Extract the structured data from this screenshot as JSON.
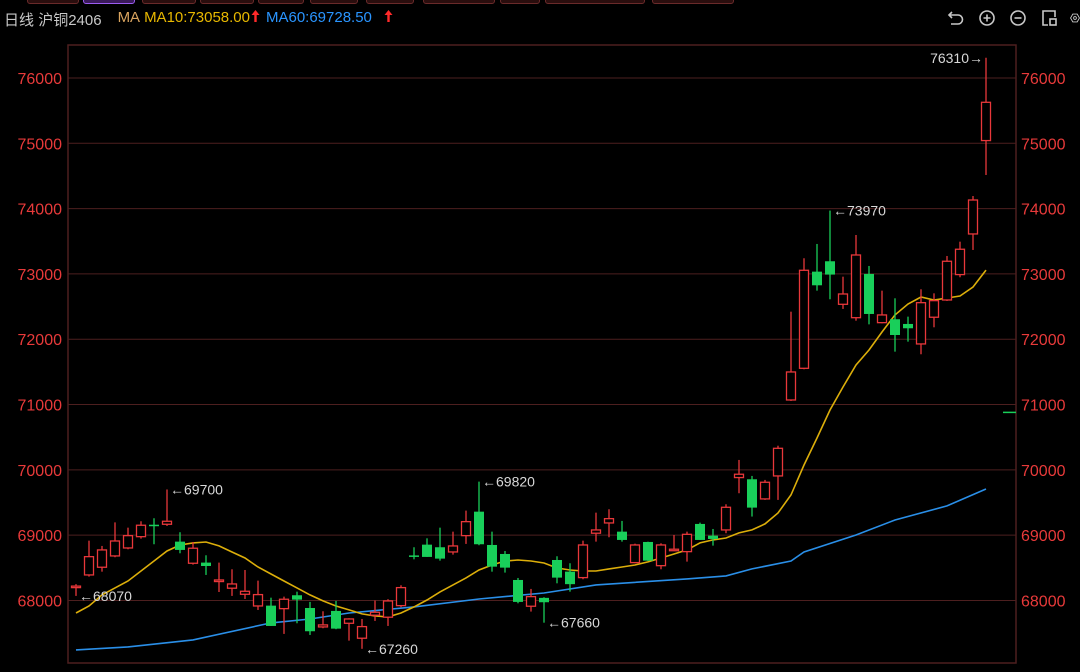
{
  "header": {
    "period": "日线",
    "symbol": "沪铜2406",
    "ma_label": "MA",
    "ma10_text": "MA10:73058.00",
    "ma60_text": "MA60:69728.50",
    "up_arrow": "🡡"
  },
  "toolbar": {
    "icons": [
      "undo-icon",
      "zoom-in-icon",
      "zoom-out-icon",
      "layout-icon",
      "settings-icon"
    ]
  },
  "colors": {
    "up": "#e8373a",
    "down": "#19cf5a",
    "grid": "#4d1f1f",
    "axis_text": "#e83a3a",
    "ma10": "#dcae0a",
    "ma60": "#2a8fe8",
    "annotation": "#d8d8d8",
    "background": "#000000"
  },
  "chart_data": {
    "type": "candlestick",
    "title": "日线 沪铜2406",
    "ylim": [
      67000,
      76500
    ],
    "yticks": [
      68000,
      69000,
      70000,
      71000,
      72000,
      73000,
      74000,
      75000,
      76000
    ],
    "ytick_labels": [
      "68000",
      "69000",
      "70000",
      "71000",
      "72000",
      "73000",
      "74000",
      "75000",
      "76000"
    ],
    "grid": true,
    "ohlc": [
      [
        68200,
        68220,
        68250,
        68070
      ],
      [
        68391,
        68671,
        68916,
        68365
      ],
      [
        68509,
        68774,
        68835,
        68441
      ],
      [
        68682,
        68911,
        69196,
        68662
      ],
      [
        68804,
        68993,
        69115,
        68784
      ],
      [
        68977,
        69152,
        69213,
        68947
      ],
      [
        69160,
        69150,
        69259,
        68861
      ],
      [
        69167,
        69213,
        69700,
        69141
      ],
      [
        68901,
        68774,
        69045,
        68723
      ],
      [
        68570,
        68800,
        68896,
        68549
      ],
      [
        68580,
        68528,
        68692,
        68391
      ],
      [
        68290,
        68314,
        68580,
        68130
      ],
      [
        68188,
        68253,
        68478,
        68070
      ],
      [
        68095,
        68141,
        68467,
        68023
      ],
      [
        67916,
        68090,
        68304,
        67855
      ],
      [
        67921,
        67610,
        68043,
        67610
      ],
      [
        67875,
        68019,
        68059,
        67488
      ],
      [
        68080,
        68013,
        68135,
        67651
      ],
      [
        67885,
        67529,
        67978,
        67472
      ],
      [
        67595,
        67626,
        67835,
        67575
      ],
      [
        67840,
        67569,
        67993,
        67560
      ],
      [
        67651,
        67717,
        67728,
        67385
      ],
      [
        67422,
        67600,
        67717,
        67260
      ],
      [
        67775,
        67820,
        68000,
        67687
      ],
      [
        67744,
        67993,
        68020,
        67610
      ],
      [
        67921,
        68197,
        68233,
        67895
      ],
      [
        68690,
        68670,
        68815,
        68630
      ],
      [
        68855,
        68667,
        68952,
        68667
      ],
      [
        68815,
        68641,
        69115,
        68610
      ],
      [
        68743,
        68835,
        69054,
        68702
      ],
      [
        68993,
        69207,
        69376,
        68866
      ],
      [
        69360,
        68861,
        69820,
        68846
      ],
      [
        68850,
        68518,
        69054,
        68441
      ],
      [
        68712,
        68503,
        68758,
        68427
      ],
      [
        68314,
        67978,
        68345,
        67957
      ],
      [
        67912,
        68059,
        68177,
        67830
      ],
      [
        68040,
        67973,
        68050,
        67660
      ],
      [
        68620,
        68350,
        68677,
        68263
      ],
      [
        68442,
        68250,
        68570,
        68135
      ],
      [
        68350,
        68850,
        68916,
        68325
      ],
      [
        69030,
        69080,
        69345,
        68901
      ],
      [
        69187,
        69253,
        69397,
        68968
      ],
      [
        69054,
        68927,
        69218,
        68901
      ],
      [
        68580,
        68850,
        68870,
        68570
      ],
      [
        68896,
        68610,
        68900,
        68605
      ],
      [
        68533,
        68850,
        68876,
        68478
      ],
      [
        68763,
        68785,
        69003,
        68763
      ],
      [
        68748,
        69013,
        69054,
        68595
      ],
      [
        69172,
        68927,
        69192,
        68927
      ],
      [
        68993,
        68942,
        69095,
        68840
      ],
      [
        69080,
        69427,
        69473,
        69030
      ],
      [
        69882,
        69933,
        70152,
        69642
      ],
      [
        69856,
        69422,
        69907,
        69285
      ],
      [
        69555,
        69810,
        69846,
        69540
      ],
      [
        69907,
        70330,
        70370,
        69540
      ],
      [
        71070,
        71499,
        72422,
        71055
      ],
      [
        71555,
        73056,
        73240,
        71540
      ],
      [
        73035,
        72826,
        73459,
        72744
      ],
      [
        73194,
        72990,
        73970,
        72612
      ],
      [
        72535,
        72693,
        72958,
        72464
      ],
      [
        72330,
        73290,
        73596,
        72284
      ],
      [
        73000,
        72387,
        73122,
        72228
      ],
      [
        72254,
        72372,
        72744,
        72244
      ],
      [
        72306,
        72065,
        72627,
        71810
      ],
      [
        72234,
        72168,
        72346,
        71963
      ],
      [
        71928,
        72560,
        72765,
        71770
      ],
      [
        72337,
        72591,
        72703,
        72183
      ],
      [
        72601,
        73194,
        73275,
        72586
      ],
      [
        72990,
        73378,
        73494,
        72949
      ],
      [
        73612,
        74132,
        74193,
        73367
      ],
      [
        75042,
        75628,
        76310,
        74515
      ]
    ],
    "ma10": [
      67809,
      67916,
      68085,
      68192,
      68299,
      68452,
      68605,
      68758,
      68850,
      68881,
      68896,
      68835,
      68743,
      68651,
      68513,
      68406,
      68299,
      68192,
      68085,
      67993,
      67916,
      67855,
      67794,
      67763,
      67748,
      67809,
      67901,
      68008,
      68131,
      68238,
      68345,
      68467,
      68544,
      68605,
      68620,
      68605,
      68574,
      68498,
      68467,
      68452,
      68452,
      68483,
      68513,
      68544,
      68590,
      68651,
      68712,
      68774,
      68881,
      68927,
      68957,
      69034,
      69080,
      69172,
      69340,
      69616,
      70075,
      70488,
      70917,
      71269,
      71606,
      71836,
      72111,
      72372,
      72540,
      72647,
      72601,
      72632,
      72662,
      72800,
      73058
    ],
    "ma60": [
      [
        0,
        67243
      ],
      [
        4,
        67289
      ],
      [
        9,
        67396
      ],
      [
        15,
        67656
      ],
      [
        18,
        67717
      ],
      [
        21,
        67809
      ],
      [
        26,
        67901
      ],
      [
        31,
        68023
      ],
      [
        36,
        68115
      ],
      [
        40,
        68238
      ],
      [
        47,
        68330
      ],
      [
        50,
        68376
      ],
      [
        52,
        68483
      ],
      [
        55,
        68605
      ],
      [
        56,
        68743
      ],
      [
        60,
        69003
      ],
      [
        63,
        69233
      ],
      [
        67,
        69448
      ],
      [
        70,
        69707
      ]
    ],
    "annotations": [
      {
        "index": 0,
        "price": 68070,
        "text": "←68070",
        "side": "right"
      },
      {
        "index": 7,
        "price": 69700,
        "text": "←69700",
        "side": "right"
      },
      {
        "index": 22,
        "price": 67260,
        "text": "←67260",
        "side": "right"
      },
      {
        "index": 31,
        "price": 69820,
        "text": "←69820",
        "side": "right"
      },
      {
        "index": 36,
        "price": 67660,
        "text": "←67660",
        "side": "right"
      },
      {
        "index": 58,
        "price": 73970,
        "text": "←73970",
        "side": "right"
      },
      {
        "index": 70,
        "price": 76310,
        "text": "76310→",
        "side": "left"
      }
    ],
    "marker_price": 70880
  }
}
